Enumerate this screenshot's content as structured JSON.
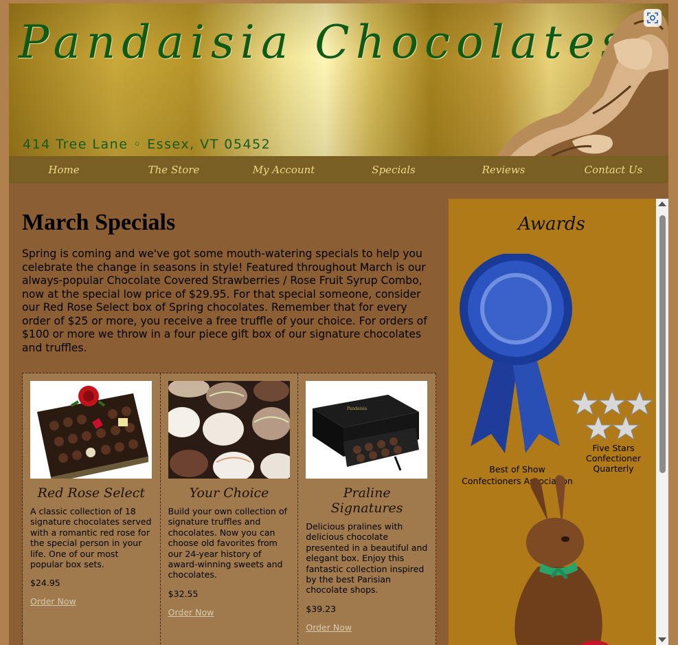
{
  "header": {
    "title": "Pandaisia Chocolates",
    "address": "414 Tree Lane ◦ Essex, VT 05452"
  },
  "nav": {
    "items": [
      "Home",
      "The Store",
      "My Account",
      "Specials",
      "Reviews",
      "Contact Us"
    ]
  },
  "main": {
    "heading": "March Specials",
    "intro": "Spring is coming and we've got some mouth-watering specials to help you celebrate the change in seasons in style! Featured throughout March is our always-popular Chocolate Covered Strawberries / Rose Fruit Syrup Combo, now at the special low price of $29.95. For that special someone, consider our Red Rose Select box of Spring chocolates. Remember that for every order of $25 or more, you receive a free truffle of your choice. For orders of $100 or more we throw in a four piece gift box of our signature chocolates and truffles.",
    "products": [
      {
        "name": "Red Rose Select",
        "description": "A classic collection of 18 signature chocolates served with a romantic red rose for the special person in your life. One of our most popular box sets.",
        "price": "$24.95",
        "order_label": "Order Now"
      },
      {
        "name": "Your Choice",
        "description": "Build your own collection of signature truffles and chocolates. Now you can choose old favorites from our 24-year history of award-winning sweets and chocolates.",
        "price": "$32.55",
        "order_label": "Order Now"
      },
      {
        "name": "Praline Signatures",
        "description": "Delicious pralines with delicious chocolate presented in a beautiful and elegant box. Enjoy this fantastic collection inspired by the best Parisian chocolate shops.",
        "price": "$39.23",
        "order_label": "Order Now"
      }
    ]
  },
  "sidebar": {
    "title": "Awards",
    "award1_line1": "Best of Show",
    "award1_line2": "Confectioners Association",
    "award2_line1": "Five Stars",
    "award2_line2": "Confectioner",
    "award2_line3": "Quarterly"
  },
  "colors": {
    "title_green": "#0f5a17",
    "nav_bg": "#7a5f24",
    "nav_text": "#f4d88a",
    "page_bg": "#8b5e34",
    "sidebar_bg": "#b07a18",
    "ribbon_blue": "#1f3f9e"
  }
}
